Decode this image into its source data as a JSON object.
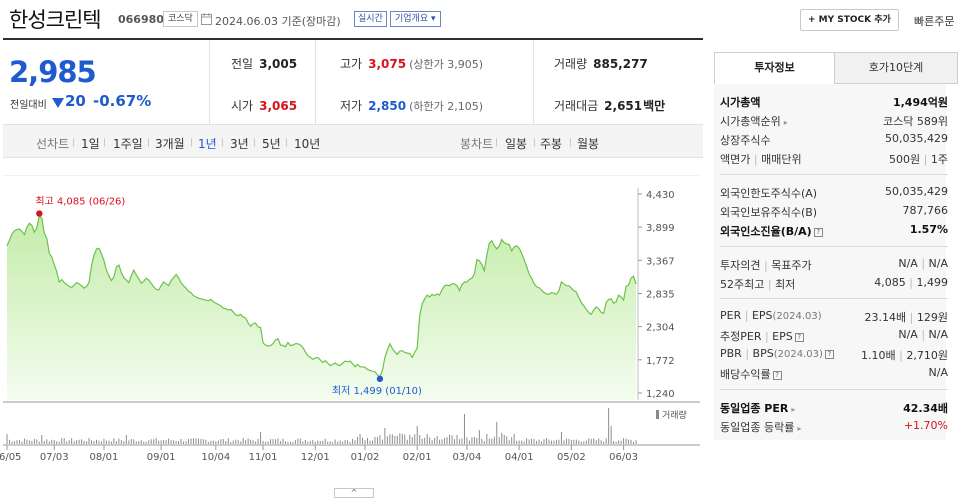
{
  "header": {
    "title": "한성크린텍",
    "code": "066980",
    "market": "코스닥",
    "date_text": "2024.06.03  기준(장마감)",
    "live_badge": "실시간",
    "company_info": "기업개요 ▾",
    "mystock_button": "+ MY STOCK 추가",
    "quick_order": "빠른주문"
  },
  "price": {
    "current": "2,985",
    "change_label": "전일대비",
    "change": "20",
    "change_pct": "-0.67%"
  },
  "quote": {
    "prev_label": "전일",
    "prev": "3,005",
    "open_label": "시가",
    "open": "3,065",
    "high_label": "고가",
    "high": "3,075",
    "upper_limit": "(상한가 3,905)",
    "low_label": "저가",
    "low": "2,850",
    "lower_limit": "(하한가 2,105)",
    "volume_label": "거래량",
    "volume": "885,277",
    "amount_label": "거래대금",
    "amount": "2,651",
    "amount_unit": "백만"
  },
  "chart_tabs": {
    "line_label": "선차트",
    "line_periods": [
      "1일",
      "1주일",
      "3개월",
      "1년",
      "3년",
      "5년",
      "10년"
    ],
    "selected": "1년",
    "candle_label": "봉차트",
    "candle_periods": [
      "일봉",
      "주봉",
      "월봉"
    ]
  },
  "chart_data": {
    "type": "area",
    "y_ticks": [
      "4,430",
      "3,899",
      "3,367",
      "2,835",
      "2,304",
      "1,772",
      "1,240"
    ],
    "ylim": [
      1240,
      4430
    ],
    "x_ticks": [
      "06/05",
      "07/03",
      "08/01",
      "09/01",
      "10/04",
      "11/01",
      "12/01",
      "01/02",
      "02/01",
      "03/04",
      "04/01",
      "05/02",
      "06/03"
    ],
    "x_tick_index": [
      0,
      19,
      39,
      62,
      84,
      103,
      124,
      144,
      165,
      185,
      206,
      227,
      248
    ],
    "high_label": "최고 4,085 (06/26)",
    "high": 4085,
    "high_index": 13,
    "low_label": "최저 1,499 (01/10)",
    "low": 1499,
    "low_index": 150,
    "volume_label": "거래량",
    "series": [
      {
        "values": [
          3600,
          3690,
          3790,
          3840,
          3860,
          3870,
          3830,
          3780,
          3900,
          3960,
          3930,
          3820,
          3880,
          4085,
          4040,
          3800,
          3720,
          3480,
          3420,
          3300,
          3190,
          3020,
          3060,
          3010,
          2980,
          2950,
          2930,
          2970,
          3010,
          2990,
          2960,
          2920,
          2950,
          3010,
          3280,
          3450,
          3550,
          3560,
          3470,
          3360,
          3210,
          3120,
          3040,
          3100,
          3260,
          3290,
          3170,
          3090,
          3050,
          3010,
          3120,
          3210,
          3130,
          3070,
          3000,
          3030,
          3080,
          3050,
          3000,
          2940,
          2900,
          2890,
          2960,
          3020,
          2990,
          2960,
          3040,
          3090,
          3140,
          3090,
          3010,
          2960,
          2920,
          2870,
          2850,
          2800,
          2780,
          2760,
          2750,
          2740,
          2730,
          2720,
          2740,
          2700,
          2680,
          2660,
          2640,
          2600,
          2590,
          2570,
          2580,
          2540,
          2490,
          2480,
          2500,
          2460,
          2440,
          2360,
          2310,
          2350,
          2360,
          2300,
          2290,
          2040,
          2010,
          1990,
          2000,
          2030,
          2090,
          2110,
          2010,
          2000,
          1980,
          2050,
          2000,
          2010,
          2030,
          2030,
          2010,
          1970,
          1900,
          1840,
          1810,
          1780,
          1800,
          1810,
          1770,
          1730,
          1760,
          1720,
          1680,
          1700,
          1720,
          1690,
          1680,
          1720,
          1750,
          1740,
          1750,
          1710,
          1660,
          1700,
          1660,
          1660,
          1650,
          1620,
          1600,
          1590,
          1580,
          1530,
          1499,
          1600,
          1810,
          1930,
          2030,
          1950,
          1900,
          1860,
          1910,
          1920,
          1890,
          1880,
          1870,
          1810,
          1890,
          1960,
          2480,
          2670,
          2750,
          2810,
          2780,
          2820,
          2800,
          2830,
          2810,
          2900,
          2960,
          2970,
          2960,
          2990,
          2990,
          2960,
          2880,
          2980,
          3020,
          3020,
          3060,
          3080,
          3150,
          3380,
          3360,
          3300,
          3200,
          3450,
          3640,
          3680,
          3600,
          3550,
          3600,
          3700,
          3650,
          3630,
          3620,
          3520,
          3580,
          3600,
          3560,
          3480,
          3380,
          3270,
          3150,
          3080,
          2990,
          2940,
          2930,
          2890,
          2850,
          2830,
          2820,
          2850,
          2840,
          2820,
          2880,
          3020,
          2990,
          2960,
          2960,
          2920,
          2880,
          2860,
          2770,
          2690,
          2640,
          2580,
          2530,
          2500,
          2570,
          2620,
          2590,
          2530,
          2520,
          2690,
          2740,
          2750,
          2680,
          2700,
          2810,
          2780,
          2730,
          2950,
          2970,
          3080,
          3110,
          2985
        ]
      }
    ]
  },
  "invest": {
    "tab_active": "투자정보",
    "tab_inactive": "호가10단계",
    "rows1": [
      {
        "k": "시가총액",
        "v": "1,494억원",
        "bold": true
      },
      {
        "k": "시가총액순위",
        "v": "코스닥 589위",
        "arrow": true
      },
      {
        "k": "상장주식수",
        "v": "50,035,429"
      },
      {
        "k": "액면가",
        "k2": "매매단위",
        "v": "500원",
        "v2": "1주"
      }
    ],
    "rows2": [
      {
        "k": "외국인한도주식수(A)",
        "v": "50,035,429"
      },
      {
        "k": "외국인보유주식수(B)",
        "v": "787,766"
      },
      {
        "k": "외국인소진율(B/A)",
        "v": "1.57%",
        "bold": true,
        "help": true
      }
    ],
    "rows3": [
      {
        "k": "투자의견",
        "k2": "목표주가",
        "v": "N/A",
        "v2": "N/A"
      },
      {
        "k": "52주최고",
        "k2": "최저",
        "v": "4,085",
        "v2": "1,499"
      }
    ],
    "per_row": {
      "k": "PER",
      "k2": "EPS",
      "k2sub": "(2024.03)",
      "v": "23.14배",
      "v2": "129원"
    },
    "est_row": {
      "k": "추정PER",
      "k2": "EPS",
      "v": "N/A",
      "v2": "N/A"
    },
    "pbr_row": {
      "k": "PBR",
      "k2": "BPS",
      "k2sub": "(2024.03)",
      "v": "1.10배",
      "v2": "2,710원"
    },
    "div_row": {
      "k": "배당수익률",
      "v": "N/A"
    },
    "ind_per": {
      "k": "동일업종 PER",
      "v": "42.34배"
    },
    "ind_chg": {
      "k": "동일업종 등락률",
      "v": "+1.70%"
    }
  },
  "colors": {
    "down": "#1d5bcf",
    "up": "#d7121b",
    "line": "#6cc24a",
    "fill_top": "#c9eeb2"
  }
}
